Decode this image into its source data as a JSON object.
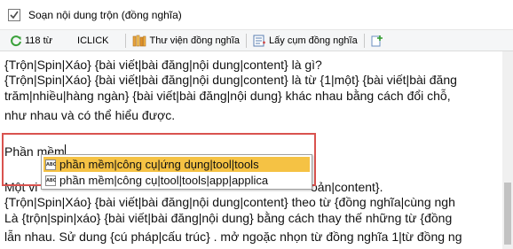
{
  "window": {
    "title": "Soạn nội dung trộn (đồng nghĩa)"
  },
  "toolbar": {
    "word_count": "118 từ",
    "iclick": "ICLICK",
    "library": "Thư viện đồng nghĩa",
    "get_phrase": "Lấy cụm đồng nghĩa"
  },
  "editor": {
    "lines": [
      "{Trộn|Spin|Xáo} {bài viết|bài đăng|nội dung|content} là gì?",
      "{Trộn|Spin|Xáo} {bài viết|bài đăng|nội dung|content} là từ {1|một} {bài viết|bài đăng",
      "trăm|nhiều|hàng ngàn} {bài viết|bài đăng|nội dung} khác nhau bằng cách đổi chỗ,",
      "như nhau và có thể hiểu được.",
      "",
      "Phần mềm",
      "",
      "Một vi",
      "{Trộn|Spin|Xáo} {bài viết|bài đăng|nội dung|content} theo từ {đồng nghĩa|cùng ngh",
      "Là {trộn|spin|xáo} {bài viết|bài đăng|nội dung} bằng cách thay thế những từ {đồng",
      "lẫn nhau. Sử dung {cú pháp|cấu trúc} . mở ngoặc nhọn từ đồng nghĩa 1|từ đồng ng"
    ],
    "line7_tail": "oản|content}."
  },
  "autocomplete": {
    "items": [
      {
        "icon": "ABC",
        "text": "phần mềm|công cụ|ứng dụng|tool|tools",
        "selected": true
      },
      {
        "icon": "ABC",
        "text": "phần mềm|công cụ|tool|tools|app|applica",
        "selected": false
      }
    ]
  },
  "colors": {
    "highlight": "#d9534f",
    "selected_bg": "#f5c244"
  }
}
